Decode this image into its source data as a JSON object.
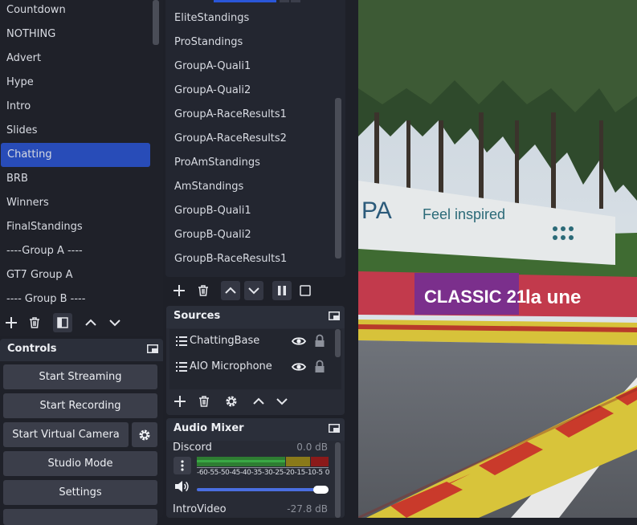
{
  "scenes": {
    "items": [
      {
        "label": "Countdown",
        "selected": false
      },
      {
        "label": "NOTHING",
        "selected": false
      },
      {
        "label": "Advert",
        "selected": false
      },
      {
        "label": "Hype",
        "selected": false
      },
      {
        "label": "Intro",
        "selected": false
      },
      {
        "label": "Slides",
        "selected": false
      },
      {
        "label": "Chatting",
        "selected": true
      },
      {
        "label": "BRB",
        "selected": false
      },
      {
        "label": "Winners",
        "selected": false
      },
      {
        "label": "FinalStandings",
        "selected": false
      },
      {
        "label": "----Group A ----",
        "selected": false
      },
      {
        "label": "GT7 Group A",
        "selected": false
      },
      {
        "label": "---- Group B ----",
        "selected": false
      }
    ]
  },
  "scene_list_2": {
    "items": [
      "EliteStandings",
      "ProStandings",
      "GroupA-Quali1",
      "GroupA-Quali2",
      "GroupA-RaceResults1",
      "GroupA-RaceResults2",
      "ProAmStandings",
      "AmStandings",
      "GroupB-Quali1",
      "GroupB-Quali2",
      "GroupB-RaceResults1"
    ]
  },
  "controls": {
    "title": "Controls",
    "start_streaming": "Start Streaming",
    "start_recording": "Start Recording",
    "start_virtual_camera": "Start Virtual Camera",
    "studio_mode": "Studio Mode",
    "settings": "Settings"
  },
  "sources": {
    "title": "Sources",
    "items": [
      {
        "label": "ChattingBase",
        "visible": true,
        "locked": true
      },
      {
        "label": "AIO Microphone",
        "visible": true,
        "locked": true
      }
    ]
  },
  "audio_mixer": {
    "title": "Audio Mixer",
    "channels": [
      {
        "name": "Discord",
        "level": "0.0 dB",
        "volume": 0.95
      },
      {
        "name": "IntroVideo",
        "level": "-27.8 dB"
      }
    ],
    "scale": [
      "-60",
      "-55",
      "-50",
      "-45",
      "-40",
      "-35",
      "-30",
      "-25",
      "-20",
      "-15",
      "-10",
      "-5",
      "0"
    ]
  },
  "preview": {
    "banner_1": "Feel inspired",
    "banner_2": "CLASSIC 21",
    "banner_3": "la une",
    "banner_left": "PA"
  },
  "colors": {
    "selection": "#284cb8",
    "accent_slider": "#4a6ee0",
    "meter_green": "#2e7d32",
    "meter_yellow": "#8a7a1a",
    "meter_red": "#8b1a1a"
  }
}
